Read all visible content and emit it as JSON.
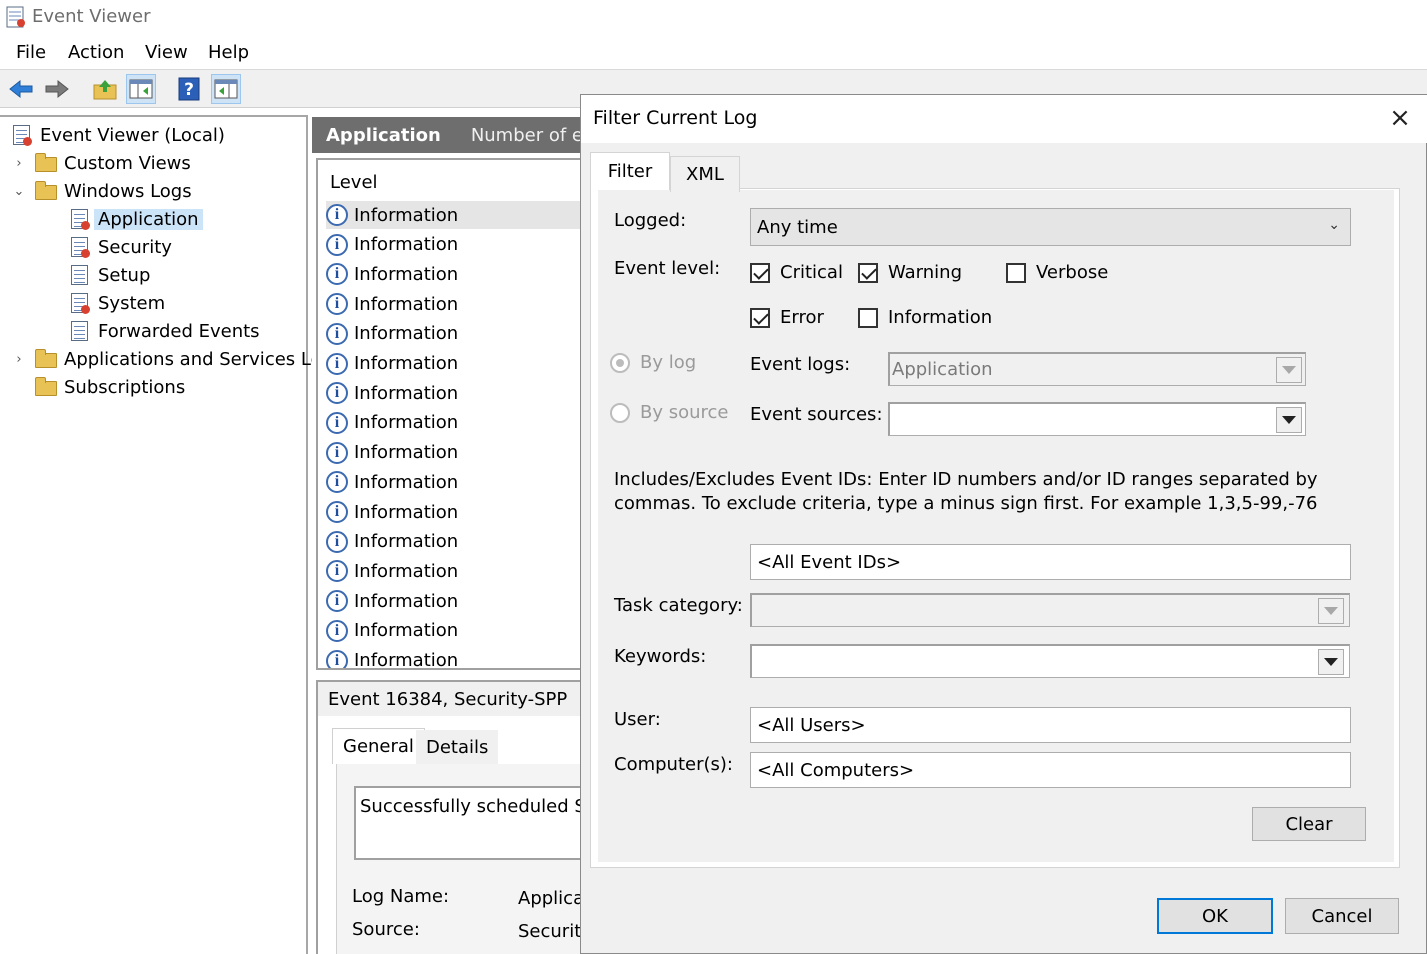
{
  "window": {
    "title": "Event Viewer"
  },
  "menu": [
    "File",
    "Action",
    "View",
    "Help"
  ],
  "tree": {
    "root": "Event Viewer (Local)",
    "custom_views": "Custom Views",
    "windows_logs": "Windows Logs",
    "logs": [
      "Application",
      "Security",
      "Setup",
      "System",
      "Forwarded Events"
    ],
    "app_services": "Applications and Services Log",
    "subscriptions": "Subscriptions"
  },
  "middle": {
    "header_name": "Application",
    "header_count": "Number of events",
    "column_level": "Level",
    "rows": [
      "Information",
      "Information",
      "Information",
      "Information",
      "Information",
      "Information",
      "Information",
      "Information",
      "Information",
      "Information",
      "Information",
      "Information",
      "Information",
      "Information",
      "Information",
      "Information"
    ],
    "event_title": "Event 16384, Security-SPP",
    "tabs": [
      "General",
      "Details"
    ],
    "description": "Successfully scheduled Software Protection",
    "log_name_label": "Log Name:",
    "log_name_value": "Application",
    "source_label": "Source:",
    "source_value": "Security-SPP"
  },
  "dialog": {
    "title": "Filter Current Log",
    "tabs": {
      "filter": "Filter",
      "xml": "XML"
    },
    "logged_label": "Logged:",
    "logged_value": "Any time",
    "event_level_label": "Event level:",
    "levels": {
      "critical": "Critical",
      "warning": "Warning",
      "verbose": "Verbose",
      "error": "Error",
      "information": "Information"
    },
    "by_log": "By log",
    "by_source": "By source",
    "event_logs_label": "Event logs:",
    "event_logs_value": "Application",
    "event_sources_label": "Event sources:",
    "help_text": "Includes/Excludes Event IDs: Enter ID numbers and/or ID ranges separated by commas. To exclude criteria, type a minus sign first. For example 1,3,5-99,-76",
    "event_ids_value": "<All Event IDs>",
    "task_category_label": "Task category:",
    "keywords_label": "Keywords:",
    "user_label": "User:",
    "user_value": "<All Users>",
    "computers_label": "Computer(s):",
    "computers_value": "<All Computers>",
    "clear_label": "Clear",
    "ok_label": "OK",
    "cancel_label": "Cancel"
  }
}
